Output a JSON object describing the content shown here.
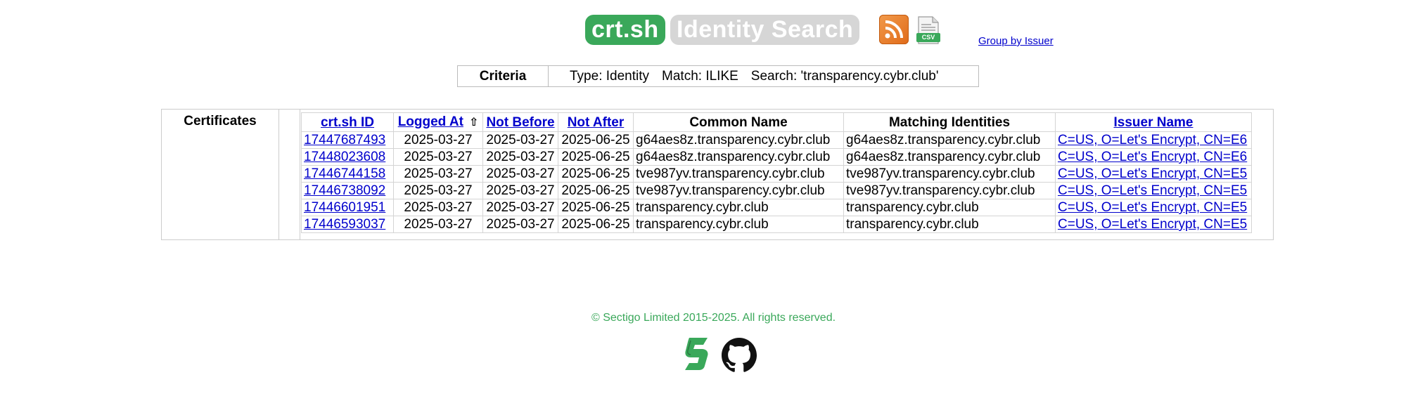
{
  "header": {
    "logo_text": "crt.sh",
    "page_title": "Identity Search",
    "rss_icon": "rss-icon",
    "csv_icon": "csv-icon",
    "csv_badge": "CSV",
    "group_link": "Group by Issuer"
  },
  "criteria": {
    "label": "Criteria",
    "type": "Type: Identity",
    "match": "Match: ILIKE",
    "search": "Search: 'transparency.cybr.club'"
  },
  "certificates": {
    "label": "Certificates",
    "columns": {
      "id": "crt.sh ID",
      "logged_at": "Logged At",
      "sort_indicator": "⇧",
      "not_before": "Not Before",
      "not_after": "Not After",
      "common_name": "Common Name",
      "matching_identities": "Matching Identities",
      "issuer_name": "Issuer Name"
    },
    "rows": [
      {
        "id": "17447687493",
        "logged_at": "2025-03-27",
        "not_before": "2025-03-27",
        "not_after": "2025-06-25",
        "common_name": "g64aes8z.transparency.cybr.club",
        "matching_identities": "g64aes8z.transparency.cybr.club",
        "issuer_name": "C=US, O=Let's Encrypt, CN=E6"
      },
      {
        "id": "17448023608",
        "logged_at": "2025-03-27",
        "not_before": "2025-03-27",
        "not_after": "2025-06-25",
        "common_name": "g64aes8z.transparency.cybr.club",
        "matching_identities": "g64aes8z.transparency.cybr.club",
        "issuer_name": "C=US, O=Let's Encrypt, CN=E6"
      },
      {
        "id": "17446744158",
        "logged_at": "2025-03-27",
        "not_before": "2025-03-27",
        "not_after": "2025-06-25",
        "common_name": "tve987yv.transparency.cybr.club",
        "matching_identities": "tve987yv.transparency.cybr.club",
        "issuer_name": "C=US, O=Let's Encrypt, CN=E5"
      },
      {
        "id": "17446738092",
        "logged_at": "2025-03-27",
        "not_before": "2025-03-27",
        "not_after": "2025-06-25",
        "common_name": "tve987yv.transparency.cybr.club",
        "matching_identities": "tve987yv.transparency.cybr.club",
        "issuer_name": "C=US, O=Let's Encrypt, CN=E5"
      },
      {
        "id": "17446601951",
        "logged_at": "2025-03-27",
        "not_before": "2025-03-27",
        "not_after": "2025-06-25",
        "common_name": "transparency.cybr.club",
        "matching_identities": "transparency.cybr.club",
        "issuer_name": "C=US, O=Let's Encrypt, CN=E5"
      },
      {
        "id": "17446593037",
        "logged_at": "2025-03-27",
        "not_before": "2025-03-27",
        "not_after": "2025-06-25",
        "common_name": "transparency.cybr.club",
        "matching_identities": "transparency.cybr.club",
        "issuer_name": "C=US, O=Let's Encrypt, CN=E5"
      }
    ]
  },
  "footer": {
    "copyright": "© Sectigo Limited 2015-2025. All rights reserved.",
    "sectigo_icon": "sectigo-icon",
    "github_icon": "github-icon"
  },
  "colors": {
    "brand_green": "#3aa85a",
    "title_grey": "#d6d6d6",
    "link_blue": "#0000cc",
    "rss_orange": "#e06b1a"
  }
}
